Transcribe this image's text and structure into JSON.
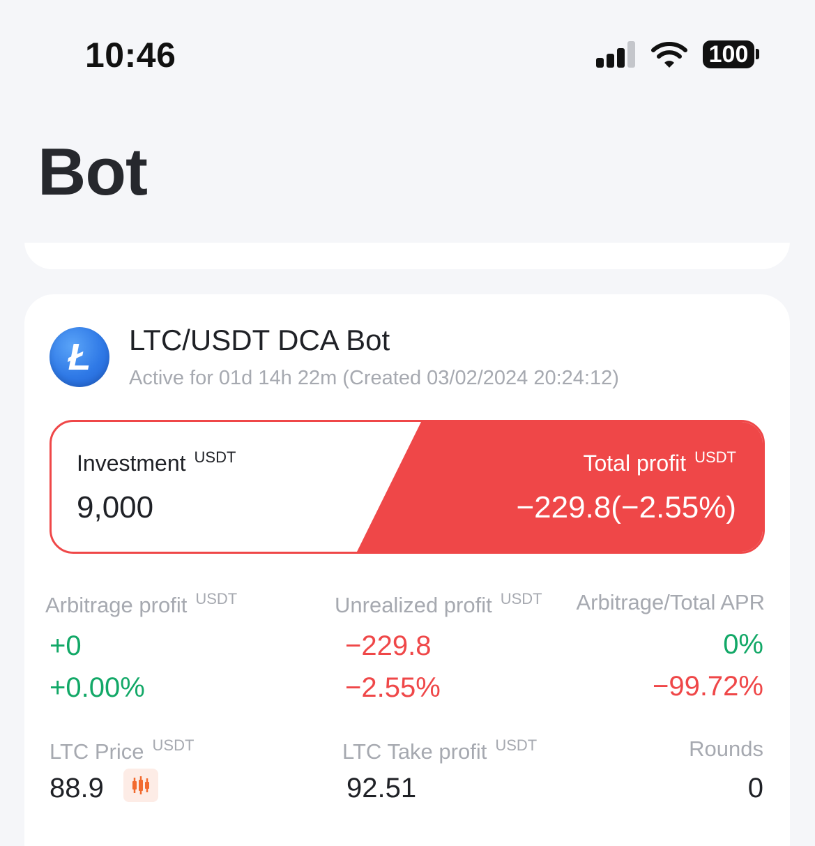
{
  "status_bar": {
    "time": "10:46",
    "battery": "100"
  },
  "header": {
    "title": "Bot"
  },
  "bot": {
    "coin_logo_letter": "Ł",
    "title": "LTC/USDT DCA Bot",
    "subtitle": "Active for 01d 14h 22m (Created 03/02/2024 20:24:12)",
    "investment": {
      "label": "Investment",
      "unit": "USDT",
      "value": "9,000"
    },
    "total_profit": {
      "label": "Total profit",
      "unit": "USDT",
      "value": "−229.8(−2.55%)"
    },
    "arbitrage_profit": {
      "label": "Arbitrage profit",
      "unit": "USDT",
      "value": "+0",
      "percent": "+0.00%"
    },
    "unrealized_profit": {
      "label": "Unrealized profit",
      "unit": "USDT",
      "value": "−229.8",
      "percent": "−2.55%"
    },
    "apr": {
      "label": "Arbitrage/Total APR",
      "arbitrage": "0%",
      "total": "−99.72%"
    },
    "price": {
      "label": "LTC Price",
      "unit": "USDT",
      "value": "88.9"
    },
    "take_profit": {
      "label": "LTC Take profit",
      "unit": "USDT",
      "value": "92.51"
    },
    "rounds": {
      "label": "Rounds",
      "value": "0"
    }
  },
  "colors": {
    "profit_red": "#ef4748",
    "profit_green": "#12a867",
    "accent_orange": "#f26a2e"
  }
}
